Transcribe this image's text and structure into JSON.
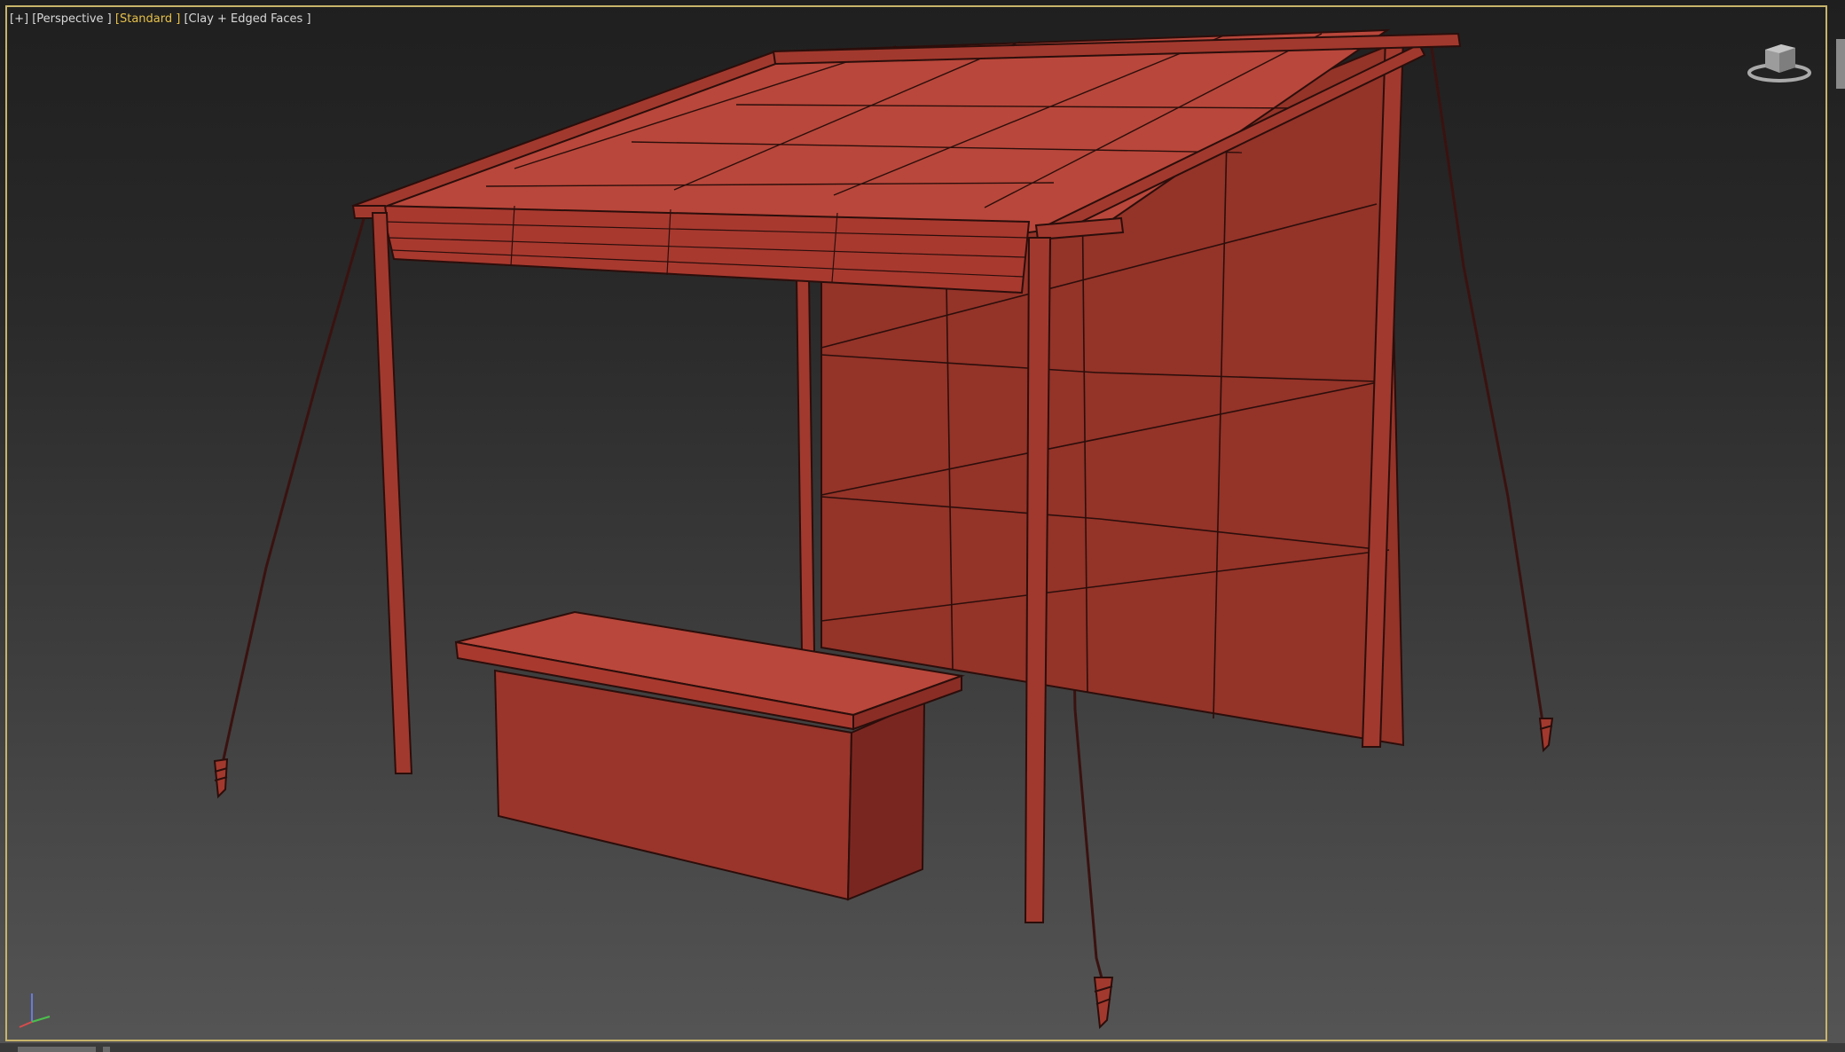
{
  "viewport_label": {
    "plus": "[+]",
    "view": "[Perspective ]",
    "shading": "[Standard ]",
    "display": "[Clay + Edged Faces ]"
  },
  "colors": {
    "border_active": "#c8b46a",
    "highlight_text": "#e6c04a",
    "clay": "#b84a3e"
  },
  "icons": {
    "viewcube": "viewcube-icon",
    "axis": "axis-gizmo-icon"
  }
}
